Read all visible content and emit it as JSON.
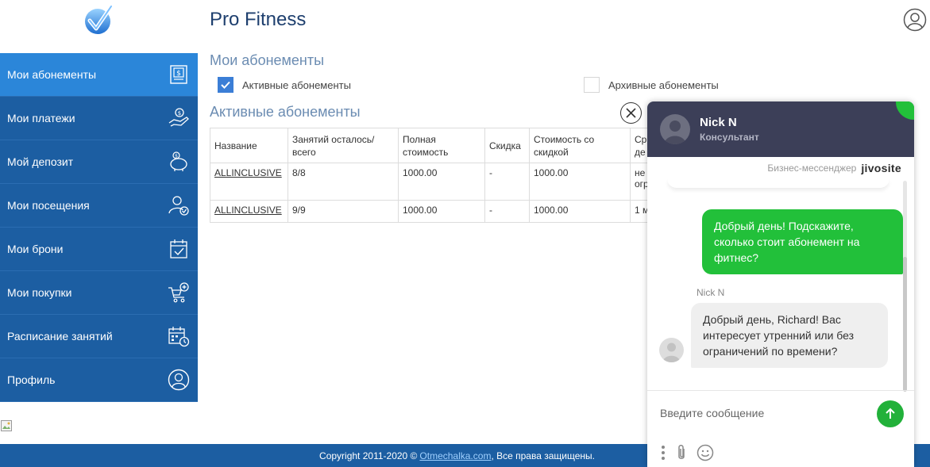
{
  "app": {
    "title": "Pro Fitness"
  },
  "sidebar": {
    "items": [
      {
        "label": "Мои абонементы",
        "icon": "receipt-icon",
        "active": true
      },
      {
        "label": "Мои платежи",
        "icon": "hand-coin-icon",
        "active": false
      },
      {
        "label": "Мой депозит",
        "icon": "piggy-bank-icon",
        "active": false
      },
      {
        "label": "Мои посещения",
        "icon": "user-check-icon",
        "active": false
      },
      {
        "label": "Мои брони",
        "icon": "calendar-check-icon",
        "active": false
      },
      {
        "label": "Мои покупки",
        "icon": "cart-plus-icon",
        "active": false
      },
      {
        "label": "Расписание занятий",
        "icon": "calendar-clock-icon",
        "active": false
      },
      {
        "label": "Профиль",
        "icon": "profile-icon",
        "active": false
      }
    ]
  },
  "main": {
    "section_title": "Мои абонементы",
    "filters": {
      "active_label": "Активные абонементы",
      "active_checked": true,
      "archive_label": "Архивные абонементы",
      "archive_checked": false
    },
    "subsection_title": "Активные абонементы",
    "table": {
      "headers": [
        "Название",
        "Занятий осталось/ всего",
        "Полная стоимость",
        "Скидка",
        "Стоимость со скидкой",
        "Ср де"
      ],
      "rows": [
        [
          "ALLINCLUSIVE",
          "8/8",
          "1000.00",
          "-",
          "1000.00",
          "не огр"
        ],
        [
          "ALLINCLUSIVE",
          "9/9",
          "1000.00",
          "-",
          "1000.00",
          "1 м"
        ]
      ]
    }
  },
  "footer": {
    "copyright": "Copyright 2011-2020 ©",
    "link": "Otmechalka.com",
    "rights": ", Все права защищены."
  },
  "chat": {
    "agent_name": "Nick N",
    "agent_role": "Консультант",
    "brand_label": "Бизнес-мессенджер",
    "brand_name": "jivosite",
    "messages": [
      {
        "from": "visitor",
        "text": "Добрый день! Подскажите, сколько стоит абонемент на фитнес?"
      },
      {
        "from": "agent",
        "sender": "Nick N",
        "text": "Добрый день, Richard! Вас интересует утренний или без ограничений по времени?"
      }
    ],
    "input_placeholder": "Введите сообщение"
  },
  "colors": {
    "sidebar": "#1c5ea2",
    "sidebar_active": "#2b86d9",
    "chat_header": "#3c3f58",
    "chat_green": "#22c03a"
  }
}
